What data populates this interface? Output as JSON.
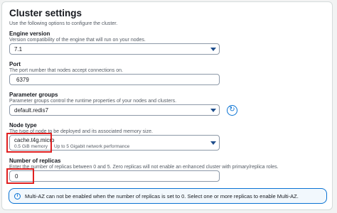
{
  "section": {
    "title": "Cluster settings",
    "description": "Use the following options to configure the cluster."
  },
  "engine_version": {
    "label": "Engine version",
    "description": "Version compatibility of the engine that will run on your nodes.",
    "value": "7.1"
  },
  "port": {
    "label": "Port",
    "description": "The port number that nodes accept connections on.",
    "value": "6379"
  },
  "parameter_groups": {
    "label": "Parameter groups",
    "description": "Parameter groups control the runtime properties of your nodes and clusters.",
    "value": "default.redis7",
    "refresh_icon": "refresh-icon"
  },
  "node_type": {
    "label": "Node type",
    "description": "The type of node to be deployed and its associated memory size.",
    "value": "cache.t4g.micro",
    "memory": "0.5 GiB memory",
    "network": "Up to 5 Gigabit network performance"
  },
  "replicas": {
    "label": "Number of replicas",
    "description": "Enter the number of replicas between 0 and 5. Zero replicas will not enable an enhanced cluster with primary/replica roles.",
    "value": "0"
  },
  "alert": {
    "icon": "info-icon",
    "text": "Multi-AZ can not be enabled when the number of replicas is set to 0. Select one or more replicas to enable Multi-AZ."
  },
  "colors": {
    "highlight": "#e02020",
    "accent": "#0972d3"
  }
}
